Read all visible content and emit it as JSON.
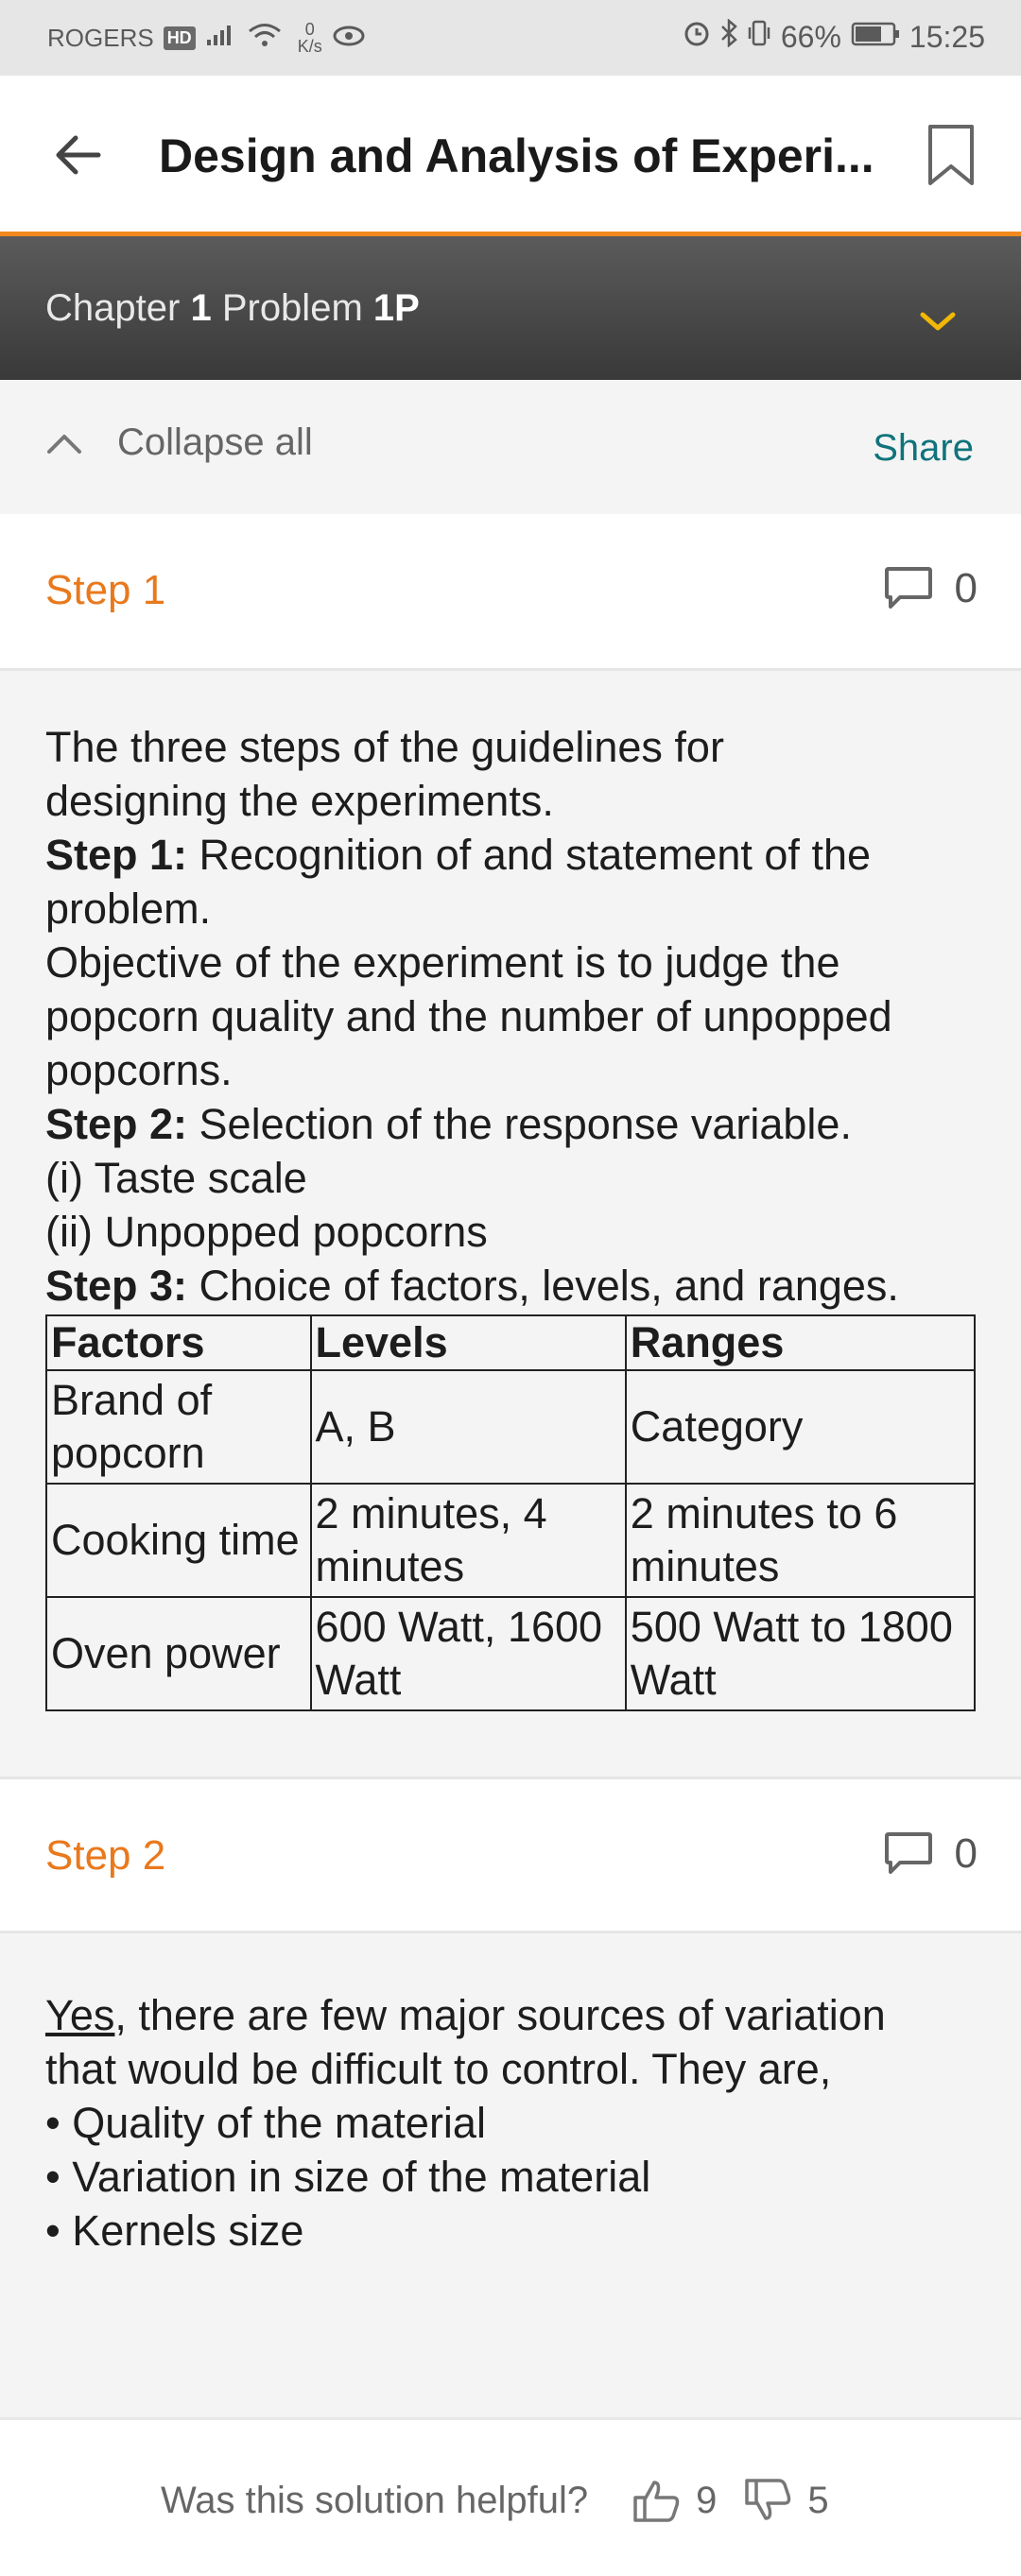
{
  "status_bar": {
    "carrier": "ROGERS",
    "hd_badge": "HD",
    "net_speed_value": "0",
    "net_speed_unit": "K/s",
    "battery": "66%",
    "time": "15:25"
  },
  "app_bar": {
    "title": "Design and Analysis of Experi..."
  },
  "chapter_bar": {
    "chapter_label": "Chapter",
    "chapter_number": "1",
    "problem_label": "Problem",
    "problem_number": "1P"
  },
  "collapse_bar": {
    "collapse_label": "Collapse all",
    "share_label": "Share"
  },
  "steps": [
    {
      "title": "Step 1",
      "comment_count": "0",
      "intro": [
        "The three steps of the guidelines for",
        "designing the experiments."
      ],
      "sub1_label": "Step 1:",
      "sub1_text": " Recognition of and statement of the",
      "sub1_cont": "problem.",
      "objective": [
        "Objective of the experiment is to judge the",
        "popcorn quality and the number of unpopped",
        "popcorns."
      ],
      "sub2_label": "Step 2:",
      "sub2_text": " Selection of the response variable.",
      "responses": [
        "(i) Taste scale",
        "(ii) Unpopped popcorns"
      ],
      "sub3_label": "Step 3:",
      "sub3_text": " Choice of factors, levels, and ranges.",
      "table": {
        "headers": [
          "Factors",
          "Levels",
          "Ranges"
        ],
        "rows": [
          [
            "Brand of popcorn",
            "A, B",
            "Category"
          ],
          [
            "Cooking time",
            "2 minutes, 4 minutes",
            "2 minutes to 6 minutes"
          ],
          [
            "Oven power",
            "600 Watt, 1600 Watt",
            "500 Watt to 1800 Watt"
          ]
        ]
      }
    },
    {
      "title": "Step 2",
      "comment_count": "0",
      "yes_word": "Yes",
      "intro_rest": ", there are few major sources of variation",
      "intro_cont": "that would be difficult to control. They are,",
      "bullets": [
        "• Quality of the material",
        "• Variation in size of the material",
        "• Kernels size"
      ]
    }
  ],
  "feedback": {
    "question": "Was this solution helpful?",
    "likes": "9",
    "dislikes": "5"
  }
}
